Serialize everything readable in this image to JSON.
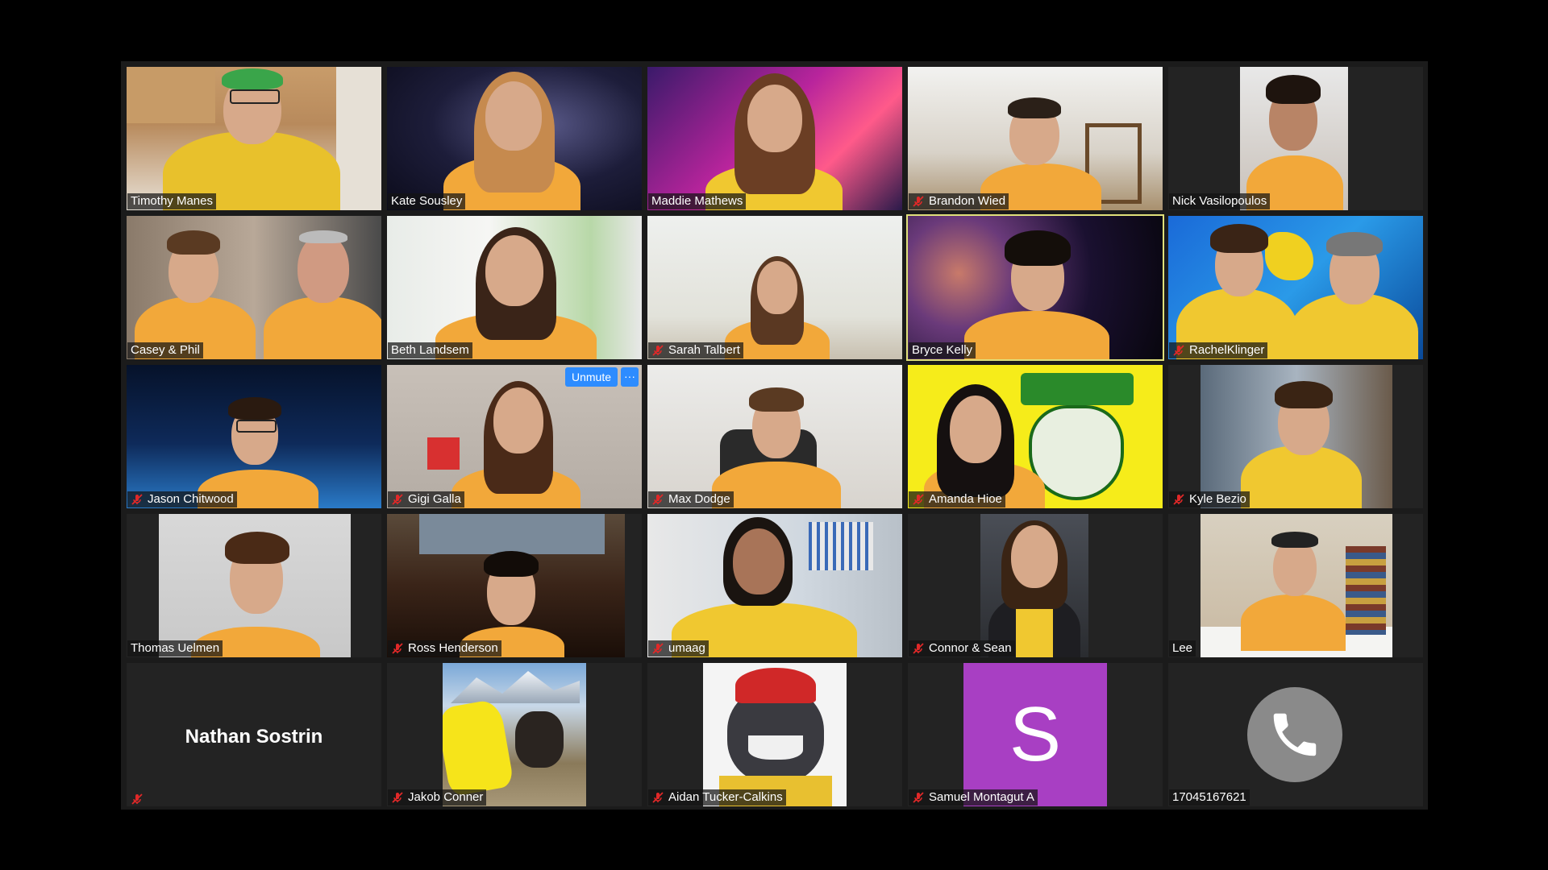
{
  "meeting": {
    "view": "Gallery View",
    "active_speaker": "Bryce Kelly"
  },
  "colors": {
    "team_shirt": "#f2a83a",
    "team_shirt_yellow": "#f0c830",
    "active_border": "#e0e07a",
    "mute_red": "#e02828",
    "zoom_blue": "#2d8cff",
    "avatar_purple": "#a83fc3"
  },
  "participants": [
    {
      "name": "Timothy Manes",
      "muted": false
    },
    {
      "name": "Kate Sousley",
      "muted": false
    },
    {
      "name": "Maddie Mathews",
      "muted": false
    },
    {
      "name": "Brandon Wied",
      "muted": true
    },
    {
      "name": "Nick Vasilopoulos",
      "muted": false
    },
    {
      "name": "Casey & Phil",
      "muted": false
    },
    {
      "name": "Beth Landsem",
      "muted": false
    },
    {
      "name": "Sarah Talbert",
      "muted": true
    },
    {
      "name": "Bryce Kelly",
      "muted": false
    },
    {
      "name": "RachelKlinger",
      "muted": true
    },
    {
      "name": "Jason Chitwood",
      "muted": true
    },
    {
      "name": "Gigi Galla",
      "muted": true
    },
    {
      "name": "Max Dodge",
      "muted": true
    },
    {
      "name": "Amanda Hioe",
      "muted": true
    },
    {
      "name": "Kyle Bezio",
      "muted": true
    },
    {
      "name": "Thomas Uelmen",
      "muted": false
    },
    {
      "name": "Ross Henderson",
      "muted": true
    },
    {
      "name": "umaag",
      "muted": true
    },
    {
      "name": "Connor & Sean",
      "muted": true
    },
    {
      "name": "Lee",
      "muted": false
    },
    {
      "name": "Nathan Sostrin",
      "muted": true
    },
    {
      "name": "Jakob Conner",
      "muted": true
    },
    {
      "name": "Aidan Tucker-Calkins",
      "muted": true
    },
    {
      "name": "Samuel Montagut A",
      "muted": true
    },
    {
      "name": "17045167621",
      "muted": false
    }
  ],
  "tile_controls": {
    "unmute_label": "Unmute",
    "more_label": "···"
  },
  "avatars": {
    "samuel_initial": "S"
  },
  "icons": {
    "mute": "muted-mic-icon",
    "phone": "phone-icon"
  }
}
